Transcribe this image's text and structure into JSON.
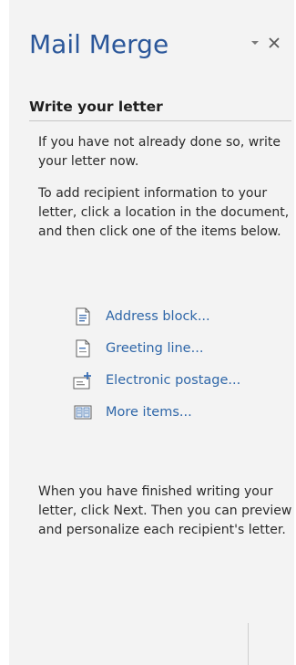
{
  "pane": {
    "title": "Mail Merge",
    "controls": {
      "options_icon": "chevron-down-icon",
      "close_icon": "close-icon"
    }
  },
  "section": {
    "heading": "Write your letter",
    "intro": "If you have not already done so, write your letter now.",
    "instructions": "To add recipient information to your letter, click a location in the document, and then click one of the items below.",
    "items": [
      {
        "label": "Address block...",
        "icon": "address-block-icon"
      },
      {
        "label": "Greeting line...",
        "icon": "greeting-line-icon"
      },
      {
        "label": "Electronic postage...",
        "icon": "electronic-postage-icon"
      },
      {
        "label": "More items...",
        "icon": "more-items-icon"
      }
    ],
    "outro": "When you have finished writing your letter, click Next. Then you can preview and personalize each recipient's letter."
  },
  "colors": {
    "title": "#2b579a",
    "link": "#2e66a8",
    "pane_bg": "#f3f3f3"
  }
}
